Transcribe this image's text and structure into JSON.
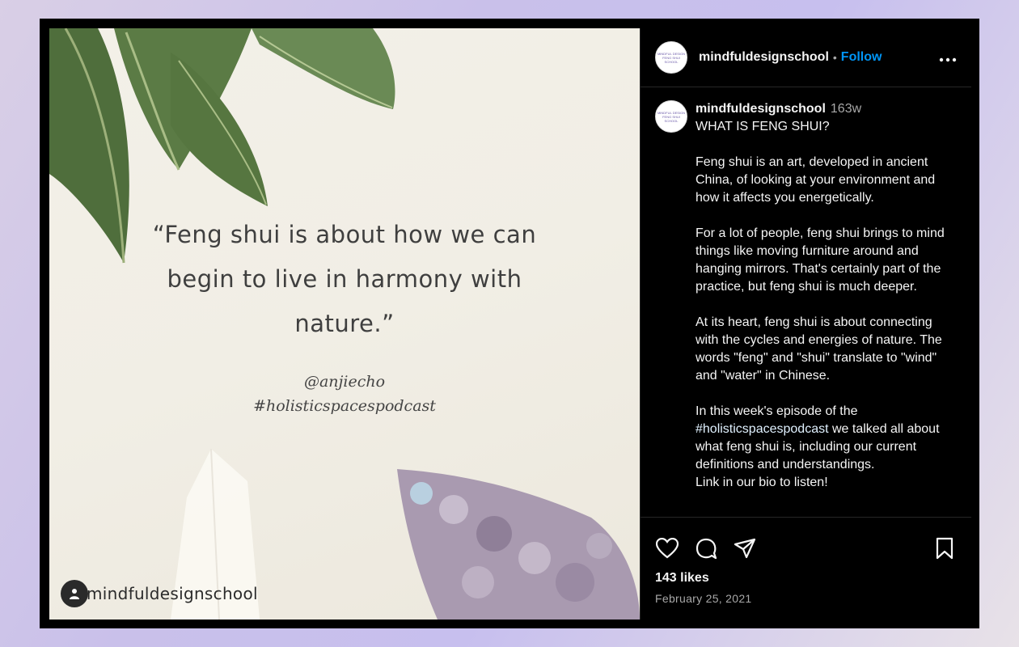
{
  "post": {
    "image": {
      "quote": "“Feng shui is about how we can begin to live in harmony with nature.”",
      "handle": "@anjiecho",
      "hashtag": "#holisticspacespodcast",
      "owner_tag": "mindfuldesignschool"
    },
    "header": {
      "username": "mindfuldesignschool",
      "separator": "•",
      "follow_label": "Follow",
      "more_icon": "more-horizontal-icon",
      "avatar_text": "MINDFUL DESIGN FENG SHUI SCHOOL"
    },
    "caption": {
      "username": "mindfuldesignschool",
      "age": "163w",
      "title": "WHAT IS FENG SHUI?",
      "p1": "Feng shui is an art, developed in ancient China, of looking at your environment and how it affects you energetically.",
      "p2": "For a lot of people, feng shui brings to mind things like moving furniture around and hanging mirrors. That's certainly part of the practice, but feng shui is much deeper.",
      "p3": "At its heart, feng shui is about connecting with the cycles and energies of nature. The words \"feng\" and \"shui\" translate to \"wind\" and \"water\" in Chinese.",
      "p4_before": "In this week's episode of the ",
      "p4_hashtag": "#holisticspacespodcast",
      "p4_after": " we talked all about what feng shui is, including our current definitions and understandings.",
      "p5": "Link in our bio to listen!"
    },
    "actions": {
      "like_icon": "heart-icon",
      "comment_icon": "comment-icon",
      "share_icon": "send-icon",
      "save_icon": "bookmark-icon"
    },
    "likes": "143 likes",
    "date": "February 25, 2021"
  }
}
